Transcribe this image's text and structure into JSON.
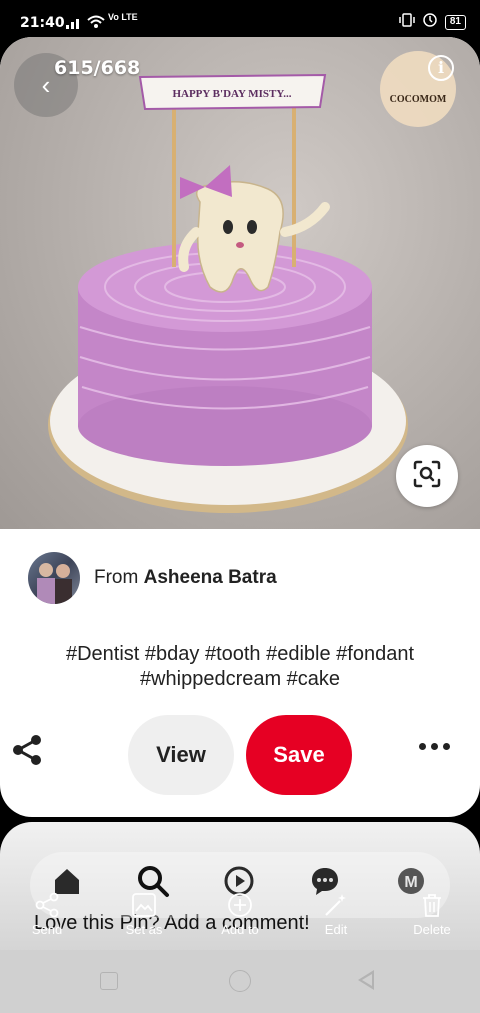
{
  "status_bar": {
    "time": "21:40",
    "network": "Vo LTE",
    "battery": "81"
  },
  "pin": {
    "counter": "615/668",
    "image": {
      "banner_text": "HAPPY B'DAY MISTY...",
      "watermark_text": "COCOMOM"
    },
    "author_prefix": "From ",
    "author_name": "Asheena Batra",
    "description": "#Dentist #bday #tooth #edible #fondant #whippedcream #cake"
  },
  "actions": {
    "view_label": "View",
    "save_label": "Save"
  },
  "comment_prompt": "Love this Pin? Add a comment!",
  "bottom_nav": {
    "profile_initial": "M"
  },
  "edit_toolbar": [
    "Send",
    "Set as",
    "Add to",
    "Edit",
    "Delete"
  ],
  "colors": {
    "save_red": "#e60023",
    "cake_pink": "#c98bcd"
  }
}
